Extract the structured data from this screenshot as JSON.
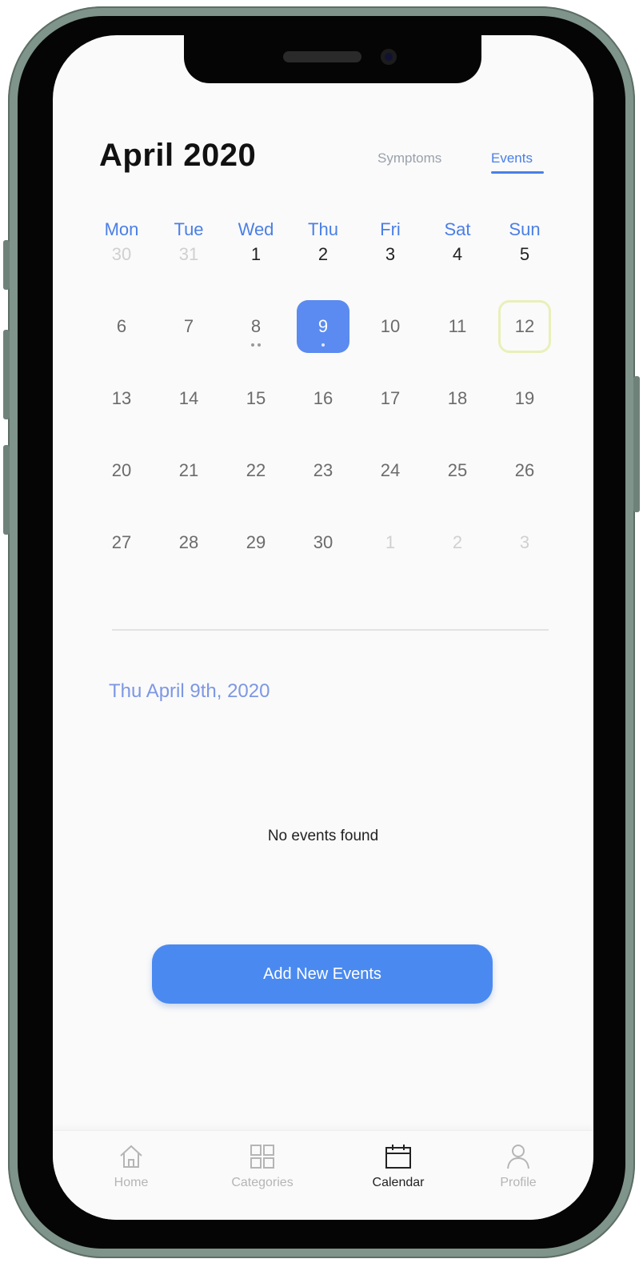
{
  "header": {
    "month_title": "April 2020",
    "toggle_symptoms": "Symptoms",
    "toggle_events": "Events",
    "active_toggle": "Events"
  },
  "calendar": {
    "weekdays": [
      "Mon",
      "Tue",
      "Wed",
      "Thu",
      "Fri",
      "Sat",
      "Sun"
    ],
    "weeks": [
      [
        "30",
        "31",
        "1",
        "2",
        "3",
        "4",
        "5"
      ],
      [
        "6",
        "7",
        "8",
        "9",
        "10",
        "11",
        "12"
      ],
      [
        "13",
        "14",
        "15",
        "16",
        "17",
        "18",
        "19"
      ],
      [
        "20",
        "21",
        "22",
        "23",
        "24",
        "25",
        "26"
      ],
      [
        "27",
        "28",
        "29",
        "30",
        "1",
        "2",
        "3"
      ]
    ],
    "selected_day": "9",
    "highlighted_day": "12",
    "days_with_events": [
      "8",
      "9"
    ]
  },
  "events_panel": {
    "selected_date_heading": "Thu April 9th, 2020",
    "empty_message": "No events found",
    "add_button_label": "Add New Events"
  },
  "tabbar": {
    "items": [
      {
        "label": "Home",
        "icon": "home-icon"
      },
      {
        "label": "Categories",
        "icon": "grid-icon"
      },
      {
        "label": "Calendar",
        "icon": "calendar-icon"
      },
      {
        "label": "Profile",
        "icon": "user-icon"
      }
    ],
    "active": "Calendar"
  },
  "colors": {
    "accent": "#4a8af0",
    "selected_day_bg": "#5b8bf0",
    "today_outline": "#e9f0b9",
    "phone_frame": "#7f948a"
  }
}
